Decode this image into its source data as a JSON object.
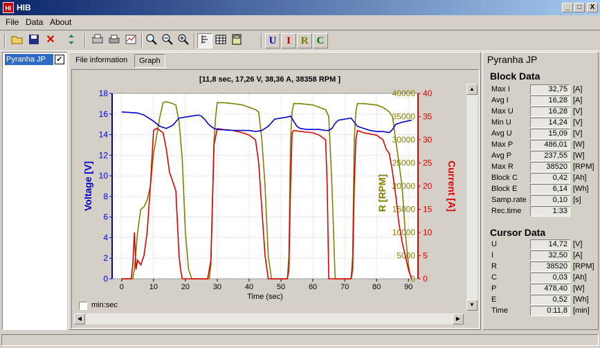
{
  "window": {
    "title": "HIB",
    "icon_text": "HI",
    "minimize": "_",
    "maximize": "□",
    "close": "X"
  },
  "menu": [
    "File",
    "Data",
    "About"
  ],
  "toolbar": {
    "icons": [
      "open-folder-icon",
      "save-disk-icon",
      "delete-x-icon",
      "move-icon",
      "print-setup-icon",
      "print-icon",
      "export-chart-icon",
      "zoom-icon",
      "zoom-out-icon",
      "zoom-in-icon",
      "cursor-line-icon",
      "table-icon",
      "calc-icon"
    ],
    "channel_buttons": [
      "U",
      "I",
      "R",
      "C"
    ],
    "channel_colors": [
      "#0000cc",
      "#cc0000",
      "#7a7a00",
      "#007a00"
    ]
  },
  "file_list": {
    "item": "Pyranha JP",
    "checked": "✓"
  },
  "tabs": [
    "File information",
    "Graph"
  ],
  "chart_data": {
    "type": "line",
    "title": "[11,8 sec, 17,26 V, 38,36 A, 38358 RPM ]",
    "xlabel": "Time (sec)",
    "xlim": [
      -3,
      93
    ],
    "xticks": [
      0,
      10,
      20,
      30,
      40,
      50,
      60,
      70,
      80,
      90
    ],
    "y_axes": [
      {
        "label": "Voltage [V]",
        "color": "#0000cc",
        "lim": [
          0,
          18
        ],
        "ticks": [
          0,
          2,
          4,
          6,
          8,
          10,
          12,
          14,
          16,
          18
        ]
      },
      {
        "label": "R [RPM]",
        "color": "#808000",
        "lim": [
          0,
          40000
        ],
        "ticks": [
          0,
          5000,
          10000,
          15000,
          20000,
          25000,
          30000,
          35000,
          40000
        ]
      },
      {
        "label": "Current [A]",
        "color": "#dd0000",
        "lim": [
          0,
          40
        ],
        "ticks": [
          0,
          5,
          10,
          15,
          20,
          25,
          30,
          35,
          40
        ]
      }
    ],
    "grid": true,
    "series": [
      {
        "axis": 0,
        "color": "#0000cc",
        "x": [
          0,
          5,
          7,
          8,
          9,
          10,
          12,
          14,
          16,
          18,
          20,
          22,
          24,
          25,
          26,
          27,
          28,
          29,
          30,
          35,
          40,
          42,
          44,
          46,
          48,
          50,
          52,
          53,
          54,
          55,
          56,
          58,
          60,
          62,
          64,
          65,
          66,
          67,
          68,
          70,
          72,
          73,
          74,
          76,
          78,
          80,
          82,
          84,
          85,
          86,
          88,
          91
        ],
        "y": [
          16.2,
          16.1,
          15.9,
          15.7,
          15.5,
          15.3,
          14.8,
          14.6,
          14.9,
          15.6,
          15.7,
          15.8,
          15.9,
          15.8,
          15.5,
          15.1,
          14.8,
          14.6,
          14.5,
          14.4,
          14.4,
          14.3,
          14.4,
          14.8,
          15.5,
          15.6,
          15.7,
          15.8,
          15.3,
          14.8,
          14.6,
          14.5,
          14.5,
          14.5,
          14.4,
          14.4,
          14.6,
          15.1,
          15.4,
          15.5,
          15.6,
          15.2,
          14.8,
          14.6,
          14.4,
          14.3,
          14.3,
          14.2,
          14.5,
          15.0,
          15.2,
          15.4
        ]
      },
      {
        "axis": 1,
        "color": "#808000",
        "x": [
          0,
          3.5,
          4,
          5,
          6,
          7,
          8,
          9,
          10,
          11,
          12,
          13,
          14,
          15,
          16,
          17,
          18,
          19,
          20,
          21,
          22,
          23,
          27.5,
          28,
          29,
          29.5,
          30,
          32,
          35,
          38,
          40,
          42,
          43,
          44,
          45,
          46,
          47,
          52,
          52.5,
          53,
          53.5,
          54,
          56,
          60,
          62,
          64,
          65,
          66,
          67,
          72,
          72.5,
          73,
          73.5,
          74,
          76,
          80,
          82,
          83,
          84,
          85,
          86,
          87,
          88,
          89,
          90,
          90.5,
          91
        ],
        "y": [
          0,
          0,
          2000,
          10000,
          15000,
          15500,
          17000,
          20000,
          27000,
          31000,
          35000,
          38000,
          38200,
          38000,
          37800,
          37500,
          34000,
          26000,
          10000,
          2000,
          0,
          0,
          0,
          3000,
          30000,
          35000,
          38000,
          38000,
          37800,
          37500,
          37000,
          36500,
          36000,
          30000,
          20000,
          5000,
          0,
          0,
          5000,
          30000,
          36000,
          37800,
          37800,
          37500,
          37000,
          36500,
          35000,
          20000,
          0,
          0,
          5000,
          30000,
          36000,
          37800,
          37800,
          37500,
          37000,
          36500,
          36000,
          35000,
          30000,
          25000,
          20000,
          10000,
          3000,
          1000,
          0
        ]
      },
      {
        "axis": 2,
        "color": "#dd0000",
        "x": [
          0,
          3,
          3.5,
          4,
          4.5,
          5,
          6,
          7,
          8,
          9,
          10,
          11,
          12,
          13,
          14,
          15,
          16,
          17,
          17.5,
          18,
          18.5,
          19,
          20,
          27,
          27.5,
          28,
          29,
          30,
          32,
          35,
          38,
          40,
          42,
          43,
          44,
          45,
          46,
          52,
          52.5,
          53,
          53.5,
          54,
          56,
          60,
          62,
          64,
          64.5,
          65,
          72,
          72.5,
          73,
          73.5,
          74,
          76,
          80,
          82,
          83,
          84,
          85,
          86,
          87,
          88,
          89,
          90,
          91
        ],
        "y": [
          0,
          0,
          3,
          10,
          2,
          4,
          3,
          5,
          10,
          20,
          32,
          32.5,
          32,
          31.5,
          28,
          23,
          21,
          19,
          12,
          5,
          2,
          0,
          0,
          0,
          2,
          4,
          29,
          32.4,
          32.2,
          32,
          31.5,
          31,
          30,
          25,
          15,
          5,
          0,
          0,
          2,
          20,
          31.5,
          32,
          31.8,
          31.5,
          31,
          30,
          20,
          0,
          0,
          2,
          20,
          30,
          32,
          31.5,
          31,
          30,
          28,
          27,
          23,
          18,
          12,
          8,
          5,
          2,
          0
        ]
      }
    ]
  },
  "min_sec_label": "min:sec",
  "right_panel": {
    "title": "Pyranha JP",
    "block_heading": "Block Data",
    "block": [
      {
        "label": "Max I",
        "value": "32,75",
        "unit": "[A]"
      },
      {
        "label": "Avg I",
        "value": "16,28",
        "unit": "[A]"
      },
      {
        "label": "Max U",
        "value": "16,28",
        "unit": "[V]"
      },
      {
        "label": "Min U",
        "value": "14,24",
        "unit": "[V]"
      },
      {
        "label": "Avg U",
        "value": "15,09",
        "unit": "[V]"
      },
      {
        "label": "Max P",
        "value": "486,01",
        "unit": "[W]"
      },
      {
        "label": "Avg P",
        "value": "237,55",
        "unit": "[W]"
      },
      {
        "label": "Max R",
        "value": "38520",
        "unit": "[RPM]"
      },
      {
        "label": "Block C",
        "value": "0,42",
        "unit": "[Ah]"
      },
      {
        "label": "Block E",
        "value": "6,14",
        "unit": "[Wh]"
      },
      {
        "label": "Samp.rate",
        "value": "0,10",
        "unit": "[s]"
      },
      {
        "label": "Rec.time",
        "value": "1:33",
        "unit": ""
      }
    ],
    "cursor_heading": "Cursor Data",
    "cursor": [
      {
        "label": "U",
        "value": "14,72",
        "unit": "[V]"
      },
      {
        "label": "I",
        "value": "32,50",
        "unit": "[A]"
      },
      {
        "label": "R",
        "value": "38520",
        "unit": "[RPM]"
      },
      {
        "label": "C",
        "value": "0,03",
        "unit": "[Ah]"
      },
      {
        "label": "P",
        "value": "478,40",
        "unit": "[W]"
      },
      {
        "label": "E",
        "value": "0,52",
        "unit": "[Wh]"
      },
      {
        "label": "Time",
        "value": "0:11,8",
        "unit": "[min]"
      }
    ]
  }
}
